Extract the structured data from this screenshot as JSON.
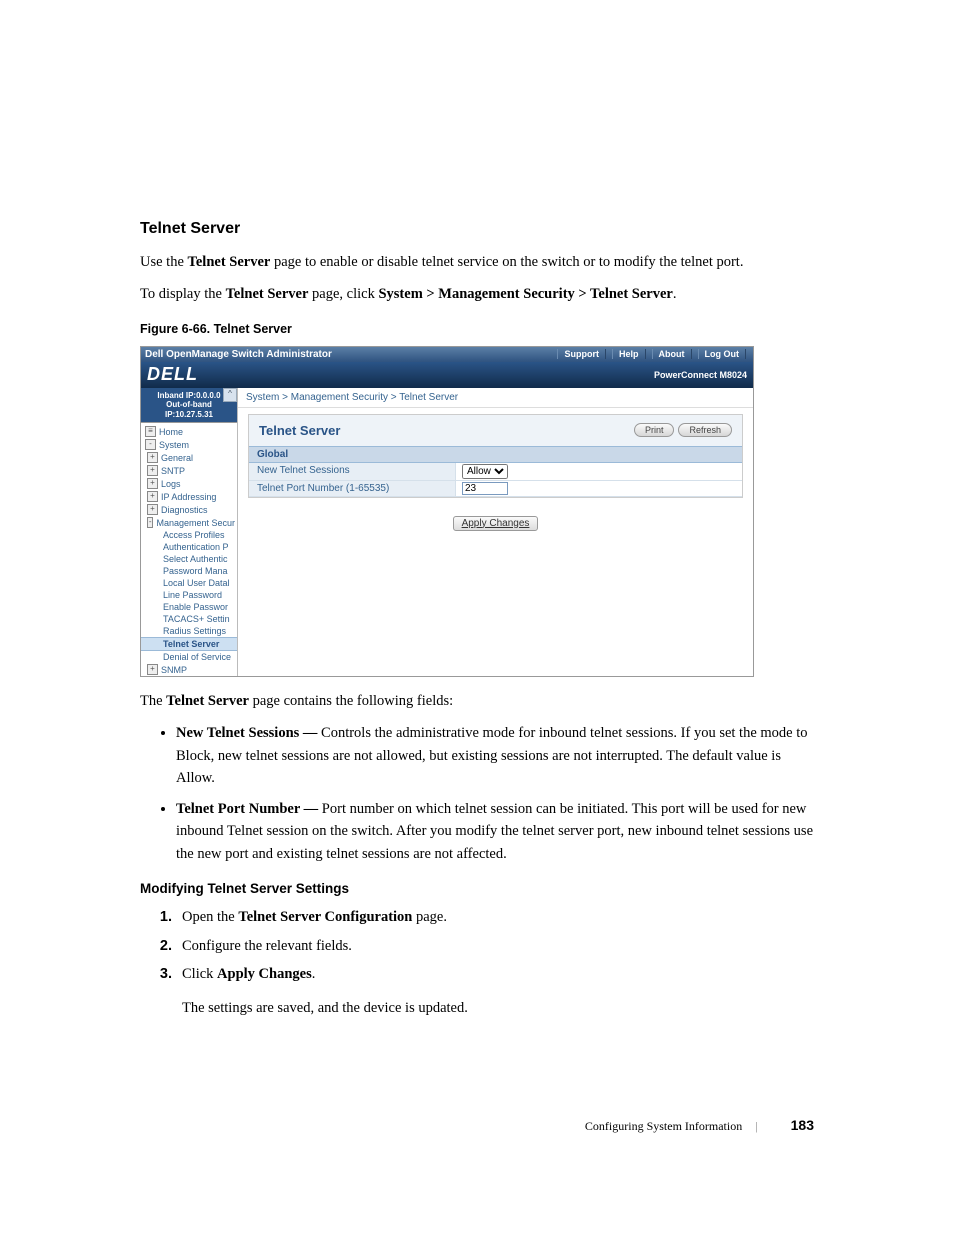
{
  "doc": {
    "section_title": "Telnet Server",
    "intro1a": "Use the ",
    "intro1b": "Telnet Server",
    "intro1c": " page to enable or disable telnet service on the switch or to modify the telnet port.",
    "intro2a": "To display the ",
    "intro2b": "Telnet Server",
    "intro2c": " page, click ",
    "intro2d": "System > Management Security > Telnet Server",
    "intro2e": ".",
    "figure_caption": "Figure 6-66.    Telnet Server",
    "after_fig": "The ",
    "after_fig_bold": "Telnet Server",
    "after_fig2": " page contains the following fields:",
    "bullets": [
      {
        "label": "New Telnet Sessions — ",
        "text": "Controls the administrative mode for inbound telnet sessions. If you set the mode to Block, new telnet sessions are not allowed, but existing sessions are not interrupted. The default value is Allow."
      },
      {
        "label": "Telnet Port Number — ",
        "text": "Port number on which telnet session can be initiated. This port will be used for new inbound Telnet session on the switch. After you modify the telnet server port, new inbound telnet sessions use the new port and existing telnet sessions are not affected."
      }
    ],
    "subsec_title": "Modifying Telnet Server Settings",
    "steps": [
      {
        "a": "Open the ",
        "b": "Telnet Server Configuration",
        "c": " page."
      },
      {
        "a": "Configure the relevant fields.",
        "b": "",
        "c": ""
      },
      {
        "a": "Click ",
        "b": "Apply Changes",
        "c": "."
      }
    ],
    "post_steps": "The settings are saved, and the device is updated.",
    "footer_section": "Configuring System Information",
    "footer_page": "183"
  },
  "shot": {
    "top_title": "Dell OpenManage Switch Administrator",
    "nav": {
      "support": "Support",
      "help": "Help",
      "about": "About",
      "logout": "Log Out"
    },
    "model": "PowerConnect M8024",
    "logo": "DELL",
    "ip1": "Inband IP:0.0.0.0",
    "ip2": "Out-of-band IP:10.27.5.31",
    "tree": {
      "home": "Home",
      "system": "System",
      "general": "General",
      "sntp": "SNTP",
      "logs": "Logs",
      "ipaddr": "IP Addressing",
      "diag": "Diagnostics",
      "mgmtsec": "Management Secur",
      "access": "Access Profiles",
      "auth": "Authentication P",
      "selauth": "Select Authentic",
      "pwdman": "Password Mana",
      "localuser": "Local User Datal",
      "linepwd": "Line Password",
      "enablepwd": "Enable Passwor",
      "tacacs": "TACACS+ Settin",
      "radius": "Radius Settings",
      "telnet": "Telnet Server",
      "dos": "Denial of Service",
      "snmp": "SNMP"
    },
    "crumb": "System > Management Security > Telnet Server",
    "panel_title": "Telnet Server",
    "btn_print": "Print",
    "btn_refresh": "Refresh",
    "global": "Global",
    "row1_label": "New Telnet Sessions",
    "row1_value": "Allow",
    "row2_label": "Telnet Port Number (1-65535)",
    "row2_value": "23",
    "apply": "Apply Changes"
  }
}
